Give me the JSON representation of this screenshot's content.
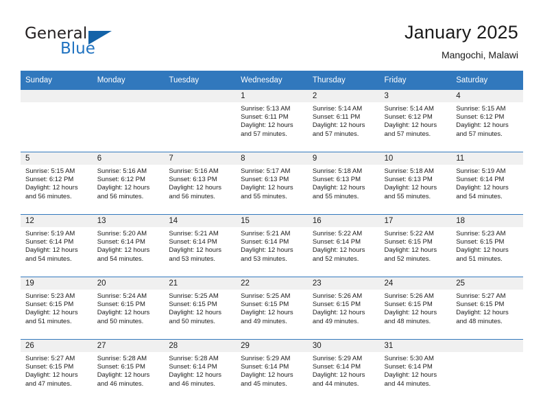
{
  "brand": {
    "word1": "General",
    "word2": "Blue",
    "logo_icon": "triangle-icon"
  },
  "header": {
    "title": "January 2025",
    "subtitle": "Mangochi, Malawi"
  },
  "colors": {
    "header_blue": "#3178bd",
    "brand_blue": "#1f72c0",
    "daynum_band": "#f0f0f0",
    "text": "#1a1a1a"
  },
  "weekdays": [
    "Sunday",
    "Monday",
    "Tuesday",
    "Wednesday",
    "Thursday",
    "Friday",
    "Saturday"
  ],
  "labels": {
    "sunrise_prefix": "Sunrise:",
    "sunset_prefix": "Sunset:",
    "daylight_prefix": "Daylight:"
  },
  "weeks": [
    [
      {
        "day": "",
        "empty": true
      },
      {
        "day": "",
        "empty": true
      },
      {
        "day": "",
        "empty": true
      },
      {
        "day": "1",
        "sunrise": "Sunrise: 5:13 AM",
        "sunset": "Sunset: 6:11 PM",
        "daylight_line1": "Daylight: 12 hours",
        "daylight_line2": "and 57 minutes."
      },
      {
        "day": "2",
        "sunrise": "Sunrise: 5:14 AM",
        "sunset": "Sunset: 6:11 PM",
        "daylight_line1": "Daylight: 12 hours",
        "daylight_line2": "and 57 minutes."
      },
      {
        "day": "3",
        "sunrise": "Sunrise: 5:14 AM",
        "sunset": "Sunset: 6:12 PM",
        "daylight_line1": "Daylight: 12 hours",
        "daylight_line2": "and 57 minutes."
      },
      {
        "day": "4",
        "sunrise": "Sunrise: 5:15 AM",
        "sunset": "Sunset: 6:12 PM",
        "daylight_line1": "Daylight: 12 hours",
        "daylight_line2": "and 57 minutes."
      }
    ],
    [
      {
        "day": "5",
        "sunrise": "Sunrise: 5:15 AM",
        "sunset": "Sunset: 6:12 PM",
        "daylight_line1": "Daylight: 12 hours",
        "daylight_line2": "and 56 minutes."
      },
      {
        "day": "6",
        "sunrise": "Sunrise: 5:16 AM",
        "sunset": "Sunset: 6:12 PM",
        "daylight_line1": "Daylight: 12 hours",
        "daylight_line2": "and 56 minutes."
      },
      {
        "day": "7",
        "sunrise": "Sunrise: 5:16 AM",
        "sunset": "Sunset: 6:13 PM",
        "daylight_line1": "Daylight: 12 hours",
        "daylight_line2": "and 56 minutes."
      },
      {
        "day": "8",
        "sunrise": "Sunrise: 5:17 AM",
        "sunset": "Sunset: 6:13 PM",
        "daylight_line1": "Daylight: 12 hours",
        "daylight_line2": "and 55 minutes."
      },
      {
        "day": "9",
        "sunrise": "Sunrise: 5:18 AM",
        "sunset": "Sunset: 6:13 PM",
        "daylight_line1": "Daylight: 12 hours",
        "daylight_line2": "and 55 minutes."
      },
      {
        "day": "10",
        "sunrise": "Sunrise: 5:18 AM",
        "sunset": "Sunset: 6:13 PM",
        "daylight_line1": "Daylight: 12 hours",
        "daylight_line2": "and 55 minutes."
      },
      {
        "day": "11",
        "sunrise": "Sunrise: 5:19 AM",
        "sunset": "Sunset: 6:14 PM",
        "daylight_line1": "Daylight: 12 hours",
        "daylight_line2": "and 54 minutes."
      }
    ],
    [
      {
        "day": "12",
        "sunrise": "Sunrise: 5:19 AM",
        "sunset": "Sunset: 6:14 PM",
        "daylight_line1": "Daylight: 12 hours",
        "daylight_line2": "and 54 minutes."
      },
      {
        "day": "13",
        "sunrise": "Sunrise: 5:20 AM",
        "sunset": "Sunset: 6:14 PM",
        "daylight_line1": "Daylight: 12 hours",
        "daylight_line2": "and 54 minutes."
      },
      {
        "day": "14",
        "sunrise": "Sunrise: 5:21 AM",
        "sunset": "Sunset: 6:14 PM",
        "daylight_line1": "Daylight: 12 hours",
        "daylight_line2": "and 53 minutes."
      },
      {
        "day": "15",
        "sunrise": "Sunrise: 5:21 AM",
        "sunset": "Sunset: 6:14 PM",
        "daylight_line1": "Daylight: 12 hours",
        "daylight_line2": "and 53 minutes."
      },
      {
        "day": "16",
        "sunrise": "Sunrise: 5:22 AM",
        "sunset": "Sunset: 6:14 PM",
        "daylight_line1": "Daylight: 12 hours",
        "daylight_line2": "and 52 minutes."
      },
      {
        "day": "17",
        "sunrise": "Sunrise: 5:22 AM",
        "sunset": "Sunset: 6:15 PM",
        "daylight_line1": "Daylight: 12 hours",
        "daylight_line2": "and 52 minutes."
      },
      {
        "day": "18",
        "sunrise": "Sunrise: 5:23 AM",
        "sunset": "Sunset: 6:15 PM",
        "daylight_line1": "Daylight: 12 hours",
        "daylight_line2": "and 51 minutes."
      }
    ],
    [
      {
        "day": "19",
        "sunrise": "Sunrise: 5:23 AM",
        "sunset": "Sunset: 6:15 PM",
        "daylight_line1": "Daylight: 12 hours",
        "daylight_line2": "and 51 minutes."
      },
      {
        "day": "20",
        "sunrise": "Sunrise: 5:24 AM",
        "sunset": "Sunset: 6:15 PM",
        "daylight_line1": "Daylight: 12 hours",
        "daylight_line2": "and 50 minutes."
      },
      {
        "day": "21",
        "sunrise": "Sunrise: 5:25 AM",
        "sunset": "Sunset: 6:15 PM",
        "daylight_line1": "Daylight: 12 hours",
        "daylight_line2": "and 50 minutes."
      },
      {
        "day": "22",
        "sunrise": "Sunrise: 5:25 AM",
        "sunset": "Sunset: 6:15 PM",
        "daylight_line1": "Daylight: 12 hours",
        "daylight_line2": "and 49 minutes."
      },
      {
        "day": "23",
        "sunrise": "Sunrise: 5:26 AM",
        "sunset": "Sunset: 6:15 PM",
        "daylight_line1": "Daylight: 12 hours",
        "daylight_line2": "and 49 minutes."
      },
      {
        "day": "24",
        "sunrise": "Sunrise: 5:26 AM",
        "sunset": "Sunset: 6:15 PM",
        "daylight_line1": "Daylight: 12 hours",
        "daylight_line2": "and 48 minutes."
      },
      {
        "day": "25",
        "sunrise": "Sunrise: 5:27 AM",
        "sunset": "Sunset: 6:15 PM",
        "daylight_line1": "Daylight: 12 hours",
        "daylight_line2": "and 48 minutes."
      }
    ],
    [
      {
        "day": "26",
        "sunrise": "Sunrise: 5:27 AM",
        "sunset": "Sunset: 6:15 PM",
        "daylight_line1": "Daylight: 12 hours",
        "daylight_line2": "and 47 minutes."
      },
      {
        "day": "27",
        "sunrise": "Sunrise: 5:28 AM",
        "sunset": "Sunset: 6:15 PM",
        "daylight_line1": "Daylight: 12 hours",
        "daylight_line2": "and 46 minutes."
      },
      {
        "day": "28",
        "sunrise": "Sunrise: 5:28 AM",
        "sunset": "Sunset: 6:14 PM",
        "daylight_line1": "Daylight: 12 hours",
        "daylight_line2": "and 46 minutes."
      },
      {
        "day": "29",
        "sunrise": "Sunrise: 5:29 AM",
        "sunset": "Sunset: 6:14 PM",
        "daylight_line1": "Daylight: 12 hours",
        "daylight_line2": "and 45 minutes."
      },
      {
        "day": "30",
        "sunrise": "Sunrise: 5:29 AM",
        "sunset": "Sunset: 6:14 PM",
        "daylight_line1": "Daylight: 12 hours",
        "daylight_line2": "and 44 minutes."
      },
      {
        "day": "31",
        "sunrise": "Sunrise: 5:30 AM",
        "sunset": "Sunset: 6:14 PM",
        "daylight_line1": "Daylight: 12 hours",
        "daylight_line2": "and 44 minutes."
      },
      {
        "day": "",
        "empty": true
      }
    ]
  ]
}
